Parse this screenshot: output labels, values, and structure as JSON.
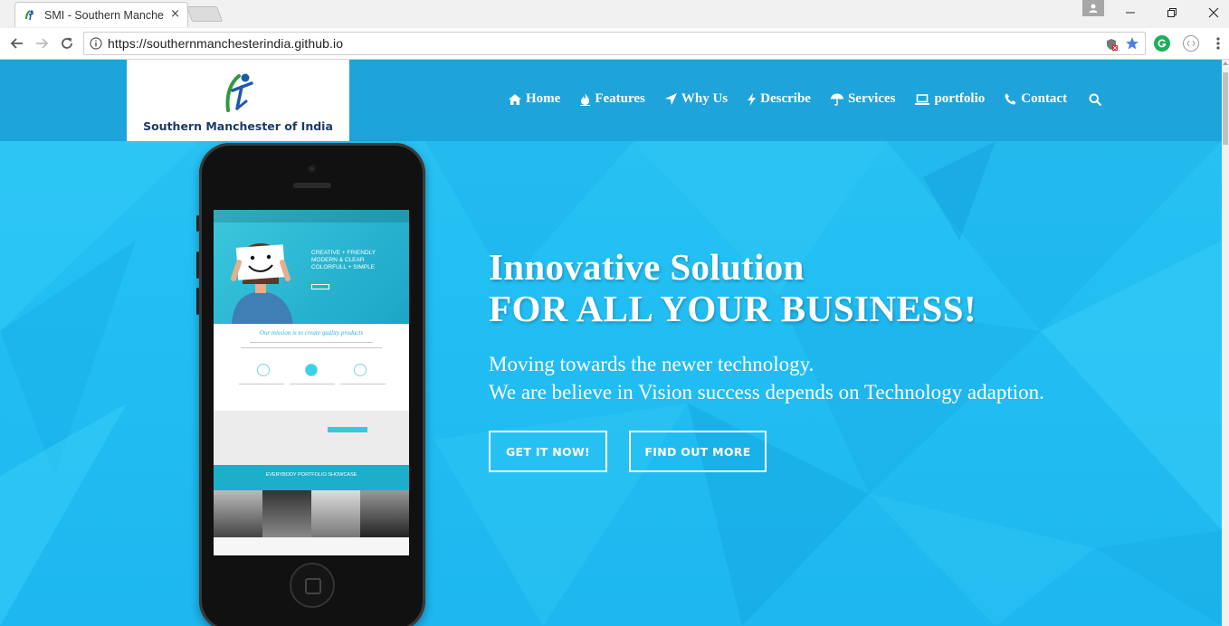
{
  "browser": {
    "tab_title": "SMI - Southern Manchester of India",
    "tab_close": "×",
    "url": "https://southernmanchesterindia.github.io",
    "window_controls": [
      "minimize-icon",
      "restore-icon",
      "close-icon"
    ]
  },
  "site": {
    "logo_text": "Southern Manchester of India",
    "nav": [
      {
        "label": "Home",
        "icon": "home-icon"
      },
      {
        "label": "Features",
        "icon": "flame-icon"
      },
      {
        "label": "Why Us",
        "icon": "location-arrow-icon"
      },
      {
        "label": "Describe",
        "icon": "bolt-icon"
      },
      {
        "label": "Services",
        "icon": "umbrella-icon"
      },
      {
        "label": "portfolio",
        "icon": "laptop-icon"
      },
      {
        "label": "Contact",
        "icon": "phone-icon"
      }
    ],
    "search_icon": "search-icon"
  },
  "hero": {
    "title_line1": "Innovative Solution",
    "title_line2": "FOR ALL YOUR BUSINESS!",
    "subtitle_line1": "Moving towards the newer technology.",
    "subtitle_line2": "We are believe in Vision success depends on Technology adaption.",
    "button_primary": "GET IT NOW!",
    "button_secondary": "FIND OUT MORE"
  },
  "phone_screen": {
    "headline": "CREATIVE + FRIENDLY MODERN & CLEAR COLORFULL + SIMPLE",
    "mission": "Our mission is to create quality products",
    "portfolio_title": "EVERYBODY PORTFOLIO SHOWCASE"
  },
  "colors": {
    "hero_bg": "#22bff3",
    "header_overlay": "#148cc8",
    "logo_text": "#1d3a68",
    "text": "#ffffff"
  }
}
